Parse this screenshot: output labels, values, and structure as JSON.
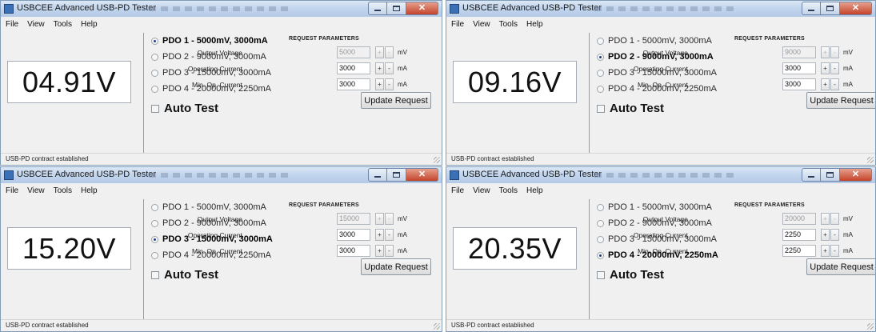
{
  "windows": [
    {
      "title": "USBCEE Advanced USB-PD Tester",
      "menu": [
        "File",
        "View",
        "Tools",
        "Help"
      ],
      "voltage": "04.91V",
      "pdos": [
        {
          "label": "PDO 1 - 5000mV, 3000mA",
          "selected": true
        },
        {
          "label": "PDO 2 - 9000mV, 3000mA",
          "selected": false
        },
        {
          "label": "PDO 3 - 15000mV, 3000mA",
          "selected": false
        },
        {
          "label": "PDO 4 - 20000mV, 2250mA",
          "selected": false
        }
      ],
      "auto_test_label": "Auto Test",
      "request_parameters": {
        "heading": "REQUEST PARAMETERS",
        "output_voltage": {
          "label": "Output Voltage",
          "value": "5000",
          "unit": "mV"
        },
        "operating_current": {
          "label": "Operating Current",
          "value": "3000",
          "unit": "mA"
        },
        "min_op_current": {
          "label": "Min. Op. Current",
          "value": "3000",
          "unit": "mA"
        }
      },
      "update_button": "Update Request",
      "status": "USB-PD contract established"
    },
    {
      "title": "USBCEE Advanced USB-PD Tester",
      "menu": [
        "File",
        "View",
        "Tools",
        "Help"
      ],
      "voltage": "09.16V",
      "pdos": [
        {
          "label": "PDO 1 - 5000mV, 3000mA",
          "selected": false
        },
        {
          "label": "PDO 2 - 9000mV, 3000mA",
          "selected": true
        },
        {
          "label": "PDO 3 - 15000mV, 3000mA",
          "selected": false
        },
        {
          "label": "PDO 4 - 20000mV, 2250mA",
          "selected": false
        }
      ],
      "auto_test_label": "Auto Test",
      "request_parameters": {
        "heading": "REQUEST PARAMETERS",
        "output_voltage": {
          "label": "Output Voltage",
          "value": "9000",
          "unit": "mV"
        },
        "operating_current": {
          "label": "Operating Current",
          "value": "3000",
          "unit": "mA"
        },
        "min_op_current": {
          "label": "Min. Op. Current",
          "value": "3000",
          "unit": "mA"
        }
      },
      "update_button": "Update Request",
      "status": "USB-PD contract established"
    },
    {
      "title": "USBCEE Advanced USB-PD Tester",
      "menu": [
        "File",
        "View",
        "Tools",
        "Help"
      ],
      "voltage": "15.20V",
      "pdos": [
        {
          "label": "PDO 1 - 5000mV, 3000mA",
          "selected": false
        },
        {
          "label": "PDO 2 - 9000mV, 3000mA",
          "selected": false
        },
        {
          "label": "PDO 3 - 15000mV, 3000mA",
          "selected": true
        },
        {
          "label": "PDO 4 - 20000mV, 2250mA",
          "selected": false
        }
      ],
      "auto_test_label": "Auto Test",
      "request_parameters": {
        "heading": "REQUEST PARAMETERS",
        "output_voltage": {
          "label": "Output Voltage",
          "value": "15000",
          "unit": "mV"
        },
        "operating_current": {
          "label": "Operating Current",
          "value": "3000",
          "unit": "mA"
        },
        "min_op_current": {
          "label": "Min. Op. Current",
          "value": "3000",
          "unit": "mA"
        }
      },
      "update_button": "Update Request",
      "status": "USB-PD contract established"
    },
    {
      "title": "USBCEE Advanced USB-PD Tester",
      "menu": [
        "File",
        "View",
        "Tools",
        "Help"
      ],
      "voltage": "20.35V",
      "pdos": [
        {
          "label": "PDO 1 - 5000mV, 3000mA",
          "selected": false
        },
        {
          "label": "PDO 2 - 9000mV, 3000mA",
          "selected": false
        },
        {
          "label": "PDO 3 - 15000mV, 3000mA",
          "selected": false
        },
        {
          "label": "PDO 4 - 20000mV, 2250mA",
          "selected": true
        }
      ],
      "auto_test_label": "Auto Test",
      "request_parameters": {
        "heading": "REQUEST PARAMETERS",
        "output_voltage": {
          "label": "Output Voltage",
          "value": "20000",
          "unit": "mV"
        },
        "operating_current": {
          "label": "Operating Current",
          "value": "2250",
          "unit": "mA"
        },
        "min_op_current": {
          "label": "Min. Op. Current",
          "value": "2250",
          "unit": "mA"
        }
      },
      "update_button": "Update Request",
      "status": "USB-PD contract established"
    }
  ]
}
